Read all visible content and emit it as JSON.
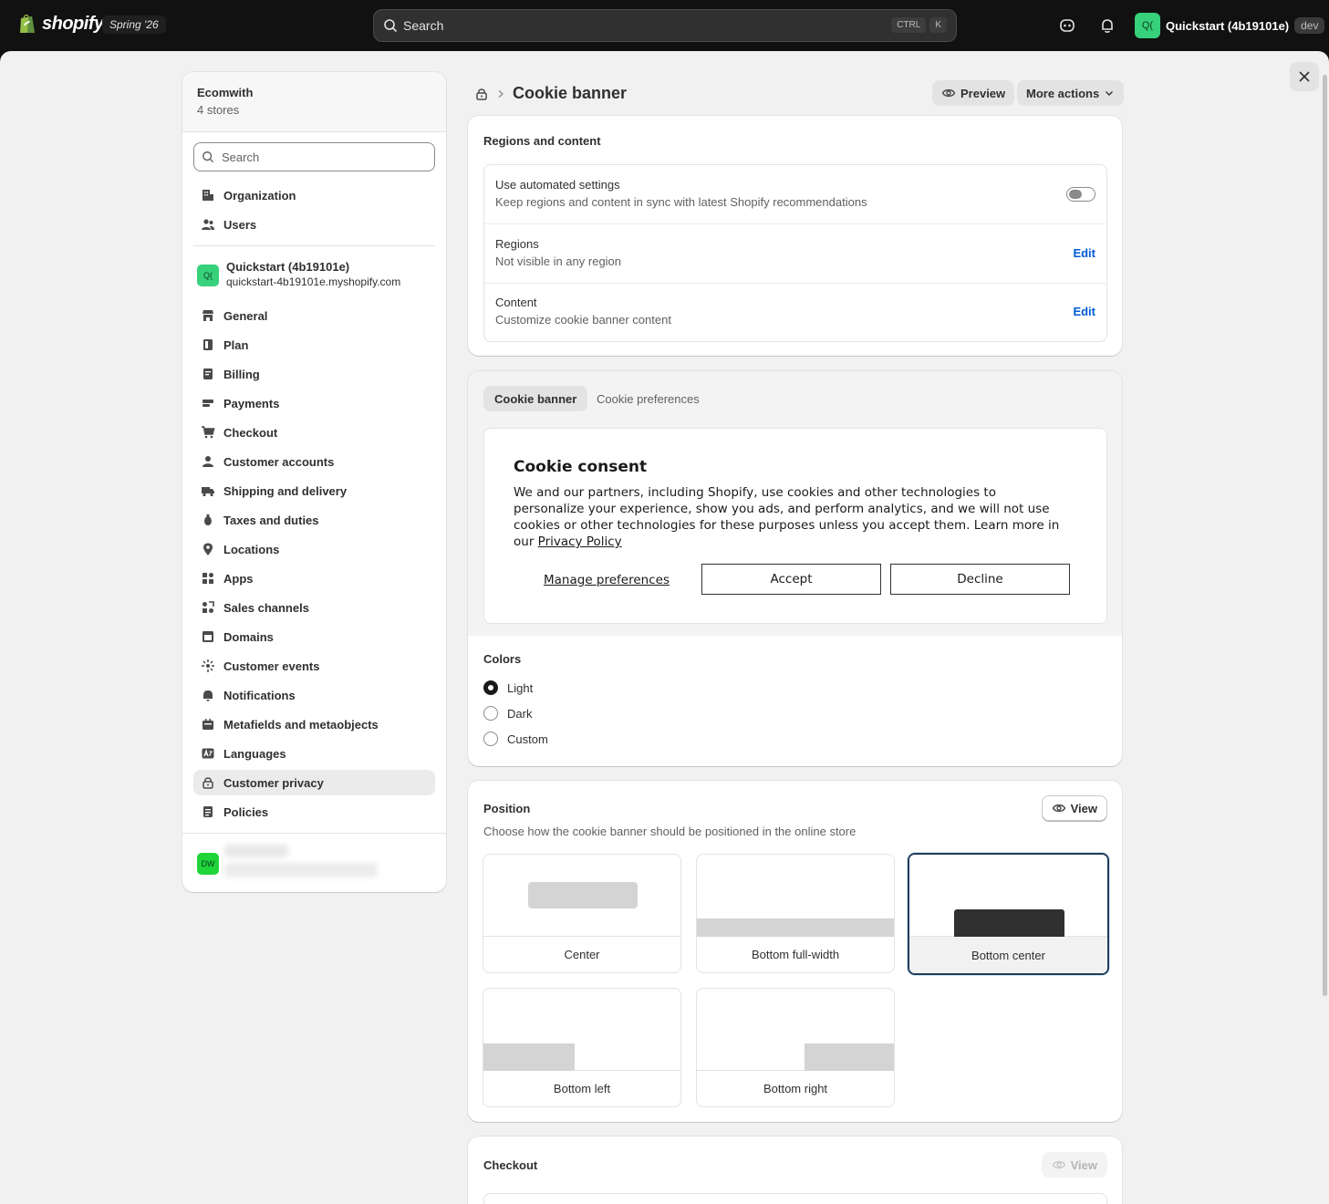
{
  "topbar": {
    "brand": "shopify",
    "edition": "Spring '26",
    "search_placeholder": "Search",
    "kbd": [
      "CTRL",
      "K"
    ],
    "store_initials": "Q(",
    "store_name": "Quickstart (4b19101e)",
    "store_badge": "dev"
  },
  "sidebar": {
    "org_name": "Ecomwith",
    "org_count": "4 stores",
    "search_placeholder": "Search",
    "org_items": [
      {
        "label": "Organization",
        "icon": "organization-icon"
      },
      {
        "label": "Users",
        "icon": "users-icon"
      }
    ],
    "store": {
      "initials": "Q(",
      "name": "Quickstart (4b19101e)",
      "url": "quickstart-4b19101e.myshopify.com"
    },
    "items": [
      {
        "label": "General",
        "icon": "store-icon"
      },
      {
        "label": "Plan",
        "icon": "plan-icon"
      },
      {
        "label": "Billing",
        "icon": "billing-icon"
      },
      {
        "label": "Payments",
        "icon": "payments-icon"
      },
      {
        "label": "Checkout",
        "icon": "cart-icon"
      },
      {
        "label": "Customer accounts",
        "icon": "person-icon"
      },
      {
        "label": "Shipping and delivery",
        "icon": "truck-icon"
      },
      {
        "label": "Taxes and duties",
        "icon": "tax-icon"
      },
      {
        "label": "Locations",
        "icon": "location-icon"
      },
      {
        "label": "Apps",
        "icon": "apps-icon"
      },
      {
        "label": "Sales channels",
        "icon": "channels-icon"
      },
      {
        "label": "Domains",
        "icon": "domains-icon"
      },
      {
        "label": "Customer events",
        "icon": "events-icon"
      },
      {
        "label": "Notifications",
        "icon": "bell-icon"
      },
      {
        "label": "Metafields and metaobjects",
        "icon": "metafields-icon"
      },
      {
        "label": "Languages",
        "icon": "language-icon"
      },
      {
        "label": "Customer privacy",
        "icon": "lock-icon",
        "active": true
      },
      {
        "label": "Policies",
        "icon": "policies-icon"
      }
    ],
    "bottom_store_initials": "DW"
  },
  "page": {
    "title": "Cookie banner",
    "preview_label": "Preview",
    "more_actions_label": "More actions"
  },
  "regions_card": {
    "title": "Regions and content",
    "rows": [
      {
        "title": "Use automated settings",
        "subtitle": "Keep regions and content in sync with latest Shopify recommendations",
        "toggle_on": false
      },
      {
        "title": "Regions",
        "subtitle": "Not visible in any region",
        "action": "Edit"
      },
      {
        "title": "Content",
        "subtitle": "Customize cookie banner content",
        "action": "Edit"
      }
    ]
  },
  "banner_card": {
    "tabs": [
      "Cookie banner",
      "Cookie preferences"
    ],
    "active_tab": "Cookie banner",
    "preview": {
      "title": "Cookie consent",
      "body": "We and our partners, including Shopify, use cookies and other technologies to personalize your experience, show you ads, and perform analytics, and we will not use cookies or other technologies for these purposes unless you accept them. Learn more in our",
      "link": "Privacy Policy",
      "manage": "Manage preferences",
      "accept": "Accept",
      "decline": "Decline"
    },
    "colors_title": "Colors",
    "color_options": [
      "Light",
      "Dark",
      "Custom"
    ],
    "selected_color": "Light"
  },
  "position_card": {
    "title": "Position",
    "subtitle": "Choose how the cookie banner should be positioned in the online store",
    "view_label": "View",
    "options": [
      "Center",
      "Bottom full-width",
      "Bottom center",
      "Bottom left",
      "Bottom right"
    ],
    "selected": "Bottom center"
  },
  "checkout_card": {
    "title": "Checkout",
    "view_label": "View"
  }
}
